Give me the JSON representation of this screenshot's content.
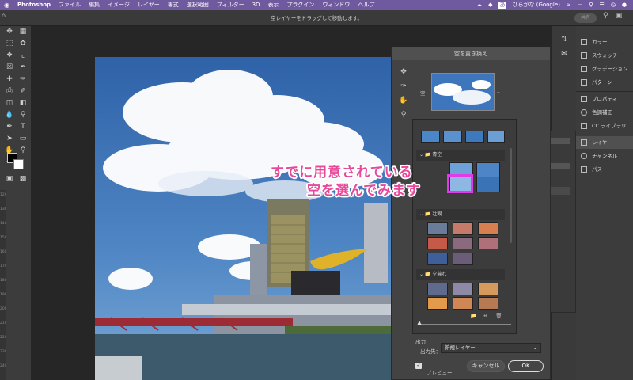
{
  "menubar": {
    "apple": "",
    "app_name": "Photoshop",
    "items": [
      "ファイル",
      "編集",
      "イメージ",
      "レイヤー",
      "書式",
      "選択範囲",
      "フィルター",
      "3D",
      "表示",
      "プラグイン",
      "ウィンドウ",
      "ヘルプ"
    ],
    "input_method": "ひらがな (Google)",
    "input_badge": "あ"
  },
  "options_bar": {
    "hint": "空レイヤーをドラッグして移動します。",
    "share_label": "共有"
  },
  "tools": {
    "fg_bg": "swatches"
  },
  "ruler_marks": [
    "1200",
    "1300",
    "1400",
    "1500",
    "1600",
    "1700",
    "1800",
    "1900",
    "2000",
    "2100",
    "2200",
    "2300",
    "2400"
  ],
  "sky_dialog": {
    "title": "空を置き換え",
    "sky_label": "空:",
    "groups": [
      {
        "name": "青空"
      },
      {
        "name": "壮観"
      },
      {
        "name": "夕暮れ"
      }
    ],
    "output_section": "出力",
    "output_to_label": "出力先：",
    "output_to_value": "新規レイヤー",
    "preview_label": "プレビュー",
    "cancel_label": "キャンセル",
    "ok_label": "OK"
  },
  "annotation": {
    "line1": "すでに用意されている",
    "line2": "空を選んでみます"
  },
  "panels": {
    "items": [
      "カラー",
      "スウォッチ",
      "グラデーション",
      "パターン",
      "プロパティ",
      "色調補正",
      "CC ライブラリ",
      "レイヤー",
      "チャンネル",
      "パス"
    ]
  },
  "colors": {
    "menubar": "#6f5aa0",
    "annotation": "#e8489a",
    "highlight": "#e13ae6",
    "sky": "#3f75b8"
  }
}
